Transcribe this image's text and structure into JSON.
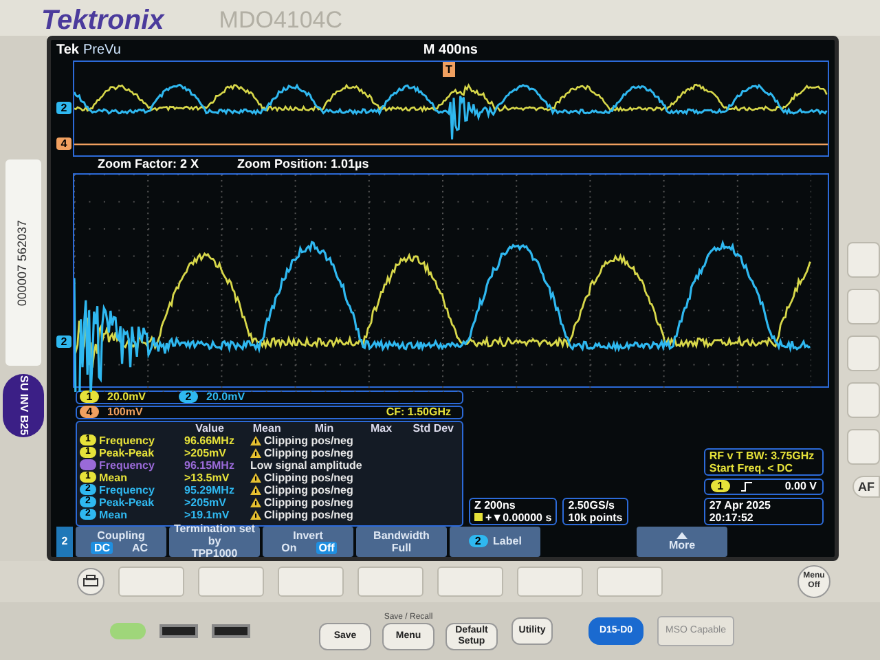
{
  "brand": {
    "name": "Tektronix",
    "model": "MDO4104C"
  },
  "sticker": {
    "number": "000007 562037",
    "tag": "SU INV B25"
  },
  "screen": {
    "logo": "Tek",
    "mode": "PreVu",
    "timebase": "M 400ns",
    "overview": {
      "trigger_marker": "T",
      "channel_markers": [
        {
          "label": "2",
          "color": "#2fb8f0"
        },
        {
          "label": "4",
          "color": "#f0a060"
        }
      ]
    },
    "zoom": {
      "factor": "Zoom Factor: 2 X",
      "position": "Zoom Position: 1.01µs"
    },
    "main": {
      "channel_marker": {
        "label": "2",
        "color": "#2fb8f0"
      }
    },
    "channels": [
      {
        "label": "1",
        "scale": "20.0mV",
        "color": "#e6e23a"
      },
      {
        "label": "2",
        "scale": "20.0mV",
        "color": "#2fb8f0"
      },
      {
        "label": "4",
        "scale": "100mV",
        "color": "#f0a060"
      }
    ],
    "center_freq": "CF: 1.50GHz",
    "measurements": {
      "columns": [
        "Value",
        "Mean",
        "Min",
        "Max",
        "Std Dev"
      ],
      "rows": [
        {
          "channel": "1",
          "color": "#e6e23a",
          "name": "Frequency",
          "value": "96.66MHz",
          "warning": true,
          "status": "Clipping pos/neg"
        },
        {
          "channel": "1",
          "color": "#e6e23a",
          "name": "Peak-Peak",
          "value": ">205mV",
          "warning": true,
          "status": "Clipping pos/neg"
        },
        {
          "color": "#9a6ad8",
          "name": "Frequency",
          "value": "96.15MHz",
          "warning": false,
          "status": "Low signal amplitude"
        },
        {
          "channel": "1",
          "color": "#e6e23a",
          "name": "Mean",
          "value": ">13.5mV",
          "warning": true,
          "status": "Clipping pos/neg"
        },
        {
          "channel": "2",
          "color": "#2fb8f0",
          "name": "Frequency",
          "value": "95.29MHz",
          "warning": true,
          "status": "Clipping pos/neg"
        },
        {
          "channel": "2",
          "color": "#2fb8f0",
          "name": "Peak-Peak",
          "value": ">205mV",
          "warning": true,
          "status": "Clipping pos/neg"
        },
        {
          "channel": "2",
          "color": "#2fb8f0",
          "name": "Mean",
          "value": ">19.1mV",
          "warning": true,
          "status": "Clipping pos/neg"
        }
      ]
    },
    "horizontal": {
      "zoom": "Z 200ns",
      "position": "+▼0.00000 s"
    },
    "acquisition": {
      "rate": "2.50GS/s",
      "length": "10k points"
    },
    "rf": {
      "bandwidth": "RF v T BW: 3.75GHz",
      "start": "Start Freq. < DC"
    },
    "trigger": {
      "source": "1",
      "color": "#e6e23a",
      "reading": "0.00 V"
    },
    "datetime": {
      "date": "27 Apr 2025",
      "time": "20:17:52"
    },
    "menu": {
      "channel": "2",
      "items": [
        {
          "kind": "toggle",
          "title": "Coupling",
          "options": [
            {
              "label": "DC",
              "selected": true
            },
            {
              "label": "AC",
              "selected": false
            }
          ]
        },
        {
          "kind": "text",
          "title": "Termination set by",
          "value": "TPP1000"
        },
        {
          "kind": "toggle",
          "title": "Invert",
          "options": [
            {
              "label": "On",
              "selected": false
            },
            {
              "label": "Off",
              "selected": true
            }
          ]
        },
        {
          "kind": "text",
          "title": "Bandwidth",
          "value": "Full"
        },
        {
          "kind": "badge",
          "badge": "2",
          "title": "Label"
        },
        {
          "kind": "blank"
        },
        {
          "kind": "more",
          "title": "More"
        }
      ]
    }
  },
  "buttons": {
    "menu_off": "Menu Off",
    "save_recall": "Save / Recall",
    "save": "Save",
    "menu": "Menu",
    "default_setup": "Default Setup",
    "utility": "Utility",
    "digital": "D15-D0",
    "mso": "MSO Capable",
    "side": "AF"
  }
}
